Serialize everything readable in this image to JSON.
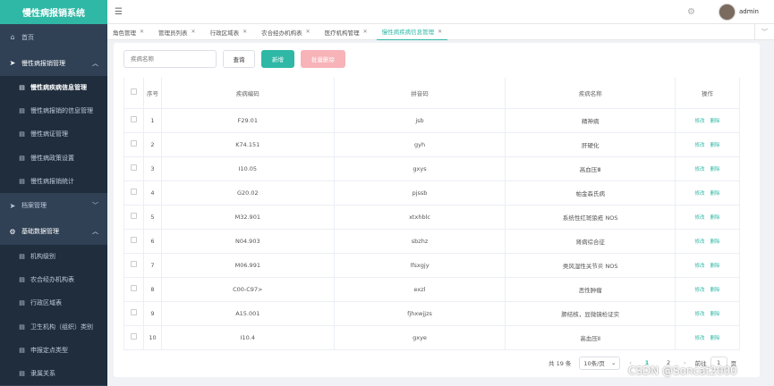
{
  "app": {
    "title": "慢性病报销系统"
  },
  "sidebar": {
    "home": "首页",
    "groups": [
      {
        "label": "慢性病报销管理",
        "items": [
          "慢性病疾病信息管理",
          "慢性病报销的信息管理",
          "慢性病证管理",
          "慢性病政策设置",
          "慢性病报销统计"
        ]
      },
      {
        "label": "档案管理",
        "items": []
      },
      {
        "label": "基础数据管理",
        "items": [
          "机构级别",
          "农合经办机构表",
          "行政区域表",
          "卫生机构（组织）类别",
          "申报定点类型",
          "隶属关系"
        ]
      }
    ]
  },
  "header": {
    "username": "admin"
  },
  "tabs": [
    "角色管理",
    "管理员列表",
    "行政区域表",
    "农合经办机构表",
    "医疗机构管理",
    "慢性病疾病信息管理"
  ],
  "toolbar": {
    "search_placeholder": "疾病名称",
    "query_label": "查询",
    "add_label": "新增",
    "batch_delete_label": "批量删除"
  },
  "table": {
    "headers": [
      "序号",
      "疾病编码",
      "拼音码",
      "疾病名称",
      "操作"
    ],
    "edit_label": "修改",
    "delete_label": "删除",
    "rows": [
      {
        "no": "1",
        "code": "F29.01",
        "pinyin": "jsb",
        "name": "精神病"
      },
      {
        "no": "2",
        "code": "K74.151",
        "pinyin": "gyh",
        "name": "肝硬化"
      },
      {
        "no": "3",
        "code": "I10.05",
        "pinyin": "gxys",
        "name": "高血压Ⅲ"
      },
      {
        "no": "4",
        "code": "G20.02",
        "pinyin": "pjssb",
        "name": "帕金森氏病"
      },
      {
        "no": "5",
        "code": "M32.901",
        "pinyin": "xtxhblc",
        "name": "系统性红斑狼疮 NOS"
      },
      {
        "no": "6",
        "code": "N04.903",
        "pinyin": "sbzhz",
        "name": "肾病综合征"
      },
      {
        "no": "7",
        "code": "M06.991",
        "pinyin": "lfsxgjy",
        "name": "类风湿性关节炎 NOS"
      },
      {
        "no": "8",
        "code": "C00-C97>",
        "pinyin": "exzl",
        "name": "恶性肿瘤"
      },
      {
        "no": "9",
        "code": "A15.001",
        "pinyin": "fjhxwjjzs",
        "name": "肺结核，显微镜检证实"
      },
      {
        "no": "10",
        "code": "I10.4",
        "pinyin": "gxye",
        "name": "高血压Ⅱ"
      }
    ]
  },
  "pager": {
    "total": "共 19 条",
    "page_size": "10条/页",
    "pages": [
      "1",
      "2"
    ],
    "goto_label": "前往",
    "goto_value": "1",
    "page_unit": "页"
  },
  "watermark": "CSDN @Soncat2000"
}
